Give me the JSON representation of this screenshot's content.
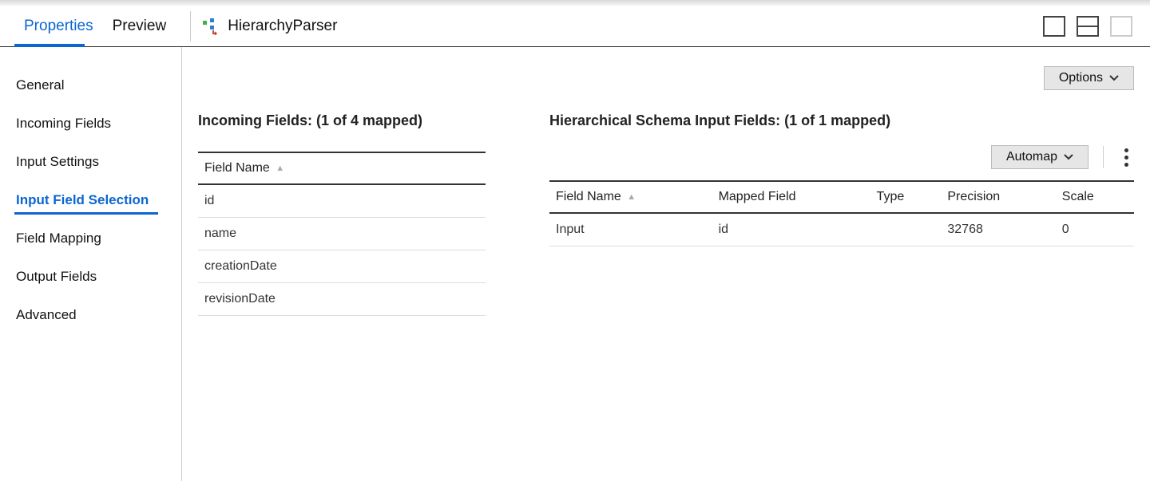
{
  "header": {
    "tabs": [
      {
        "label": "Properties",
        "active": true
      },
      {
        "label": "Preview",
        "active": false
      }
    ],
    "node_title": "HierarchyParser"
  },
  "sidebar": {
    "items": [
      {
        "label": "General"
      },
      {
        "label": "Incoming Fields"
      },
      {
        "label": "Input Settings"
      },
      {
        "label": "Input Field Selection"
      },
      {
        "label": "Field Mapping"
      },
      {
        "label": "Output Fields"
      },
      {
        "label": "Advanced"
      }
    ],
    "selected_index": 3
  },
  "toolbar": {
    "options_label": "Options",
    "automap_label": "Automap"
  },
  "incoming_fields": {
    "title": "Incoming Fields: (1 of 4 mapped)",
    "columns": {
      "field_name": "Field Name"
    },
    "rows": [
      {
        "field_name": "id"
      },
      {
        "field_name": "name"
      },
      {
        "field_name": "creationDate"
      },
      {
        "field_name": "revisionDate"
      }
    ]
  },
  "schema_fields": {
    "title": "Hierarchical Schema Input Fields: (1 of 1 mapped)",
    "columns": {
      "field_name": "Field Name",
      "mapped_field": "Mapped Field",
      "type": "Type",
      "precision": "Precision",
      "scale": "Scale"
    },
    "rows": [
      {
        "field_name": "Input",
        "mapped_field": "id",
        "type": "",
        "precision": "32768",
        "scale": "0"
      }
    ]
  }
}
